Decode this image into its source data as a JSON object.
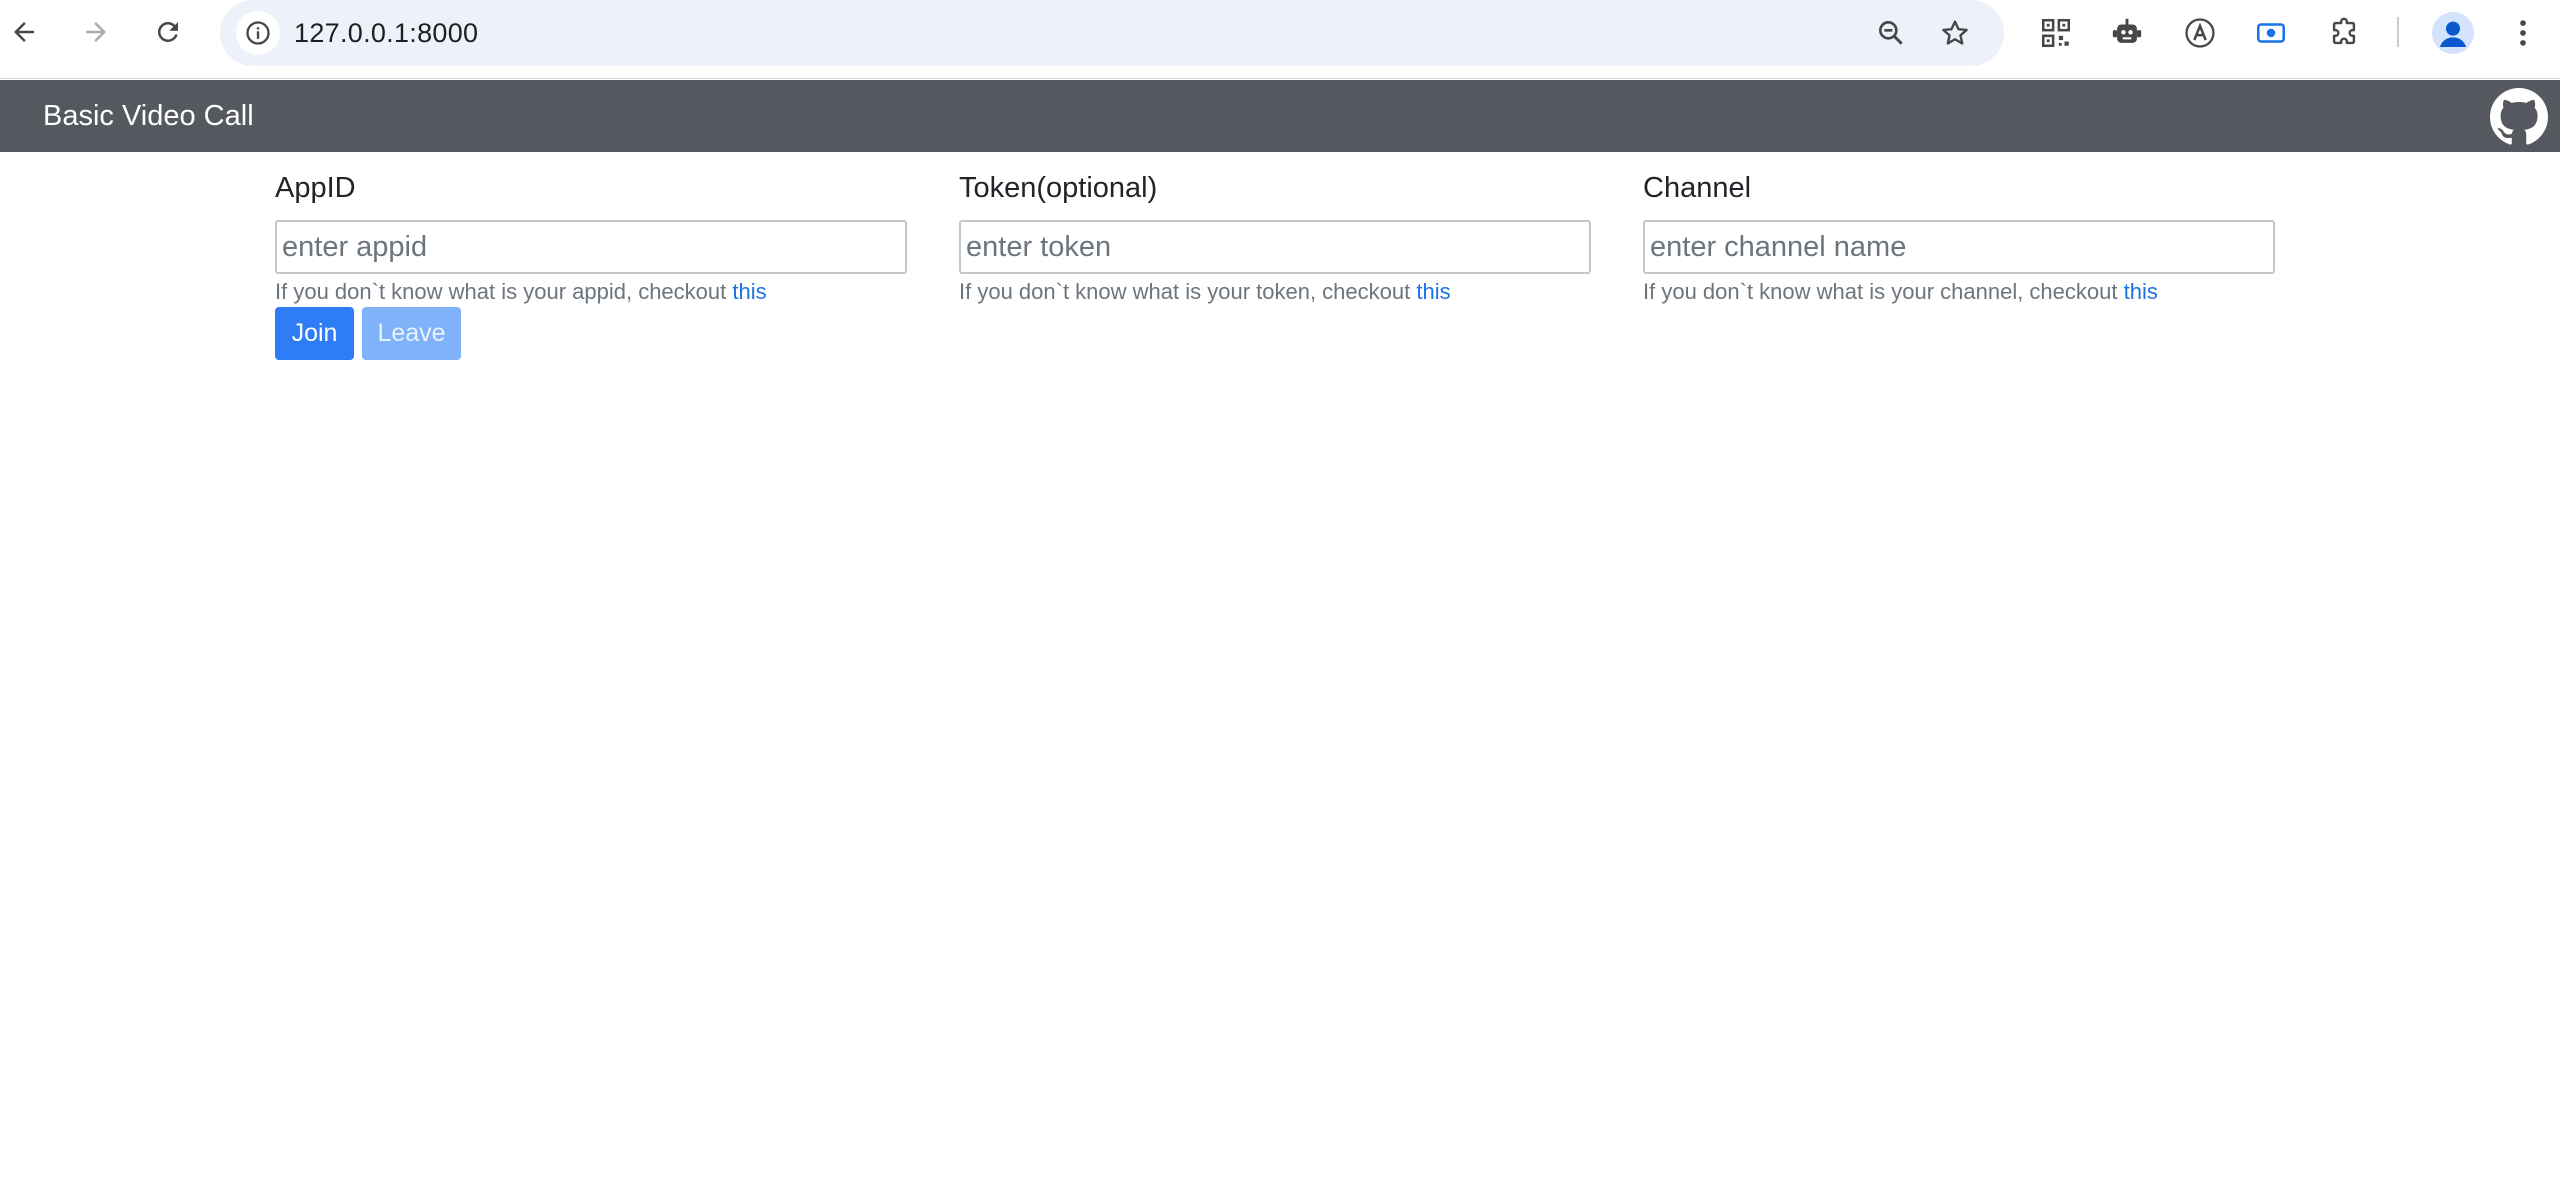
{
  "browser": {
    "url": "127.0.0.1:8000",
    "icons": [
      "back-arrow-icon",
      "forward-arrow-icon",
      "reload-icon",
      "info-icon",
      "zoom-out-icon",
      "star-icon",
      "qr-code-icon",
      "robot-icon",
      "translate-icon",
      "screen-record-icon",
      "puzzle-icon",
      "profile-icon",
      "kebab-menu-icon"
    ]
  },
  "navbar": {
    "brand": "Basic Video Call",
    "background_color": "#55595f"
  },
  "form": {
    "appid": {
      "label": "AppID",
      "placeholder": "enter appid",
      "help_text": "If you don`t know what is your appid, checkout ",
      "help_link": "this"
    },
    "token": {
      "label": "Token(optional)",
      "placeholder": "enter token",
      "help_text": "If you don`t know what is your token, checkout ",
      "help_link": "this"
    },
    "channel": {
      "label": "Channel",
      "placeholder": "enter channel name",
      "help_text": "If you don`t know what is your channel, checkout ",
      "help_link": "this"
    }
  },
  "buttons": {
    "join": "Join",
    "leave": "Leave",
    "primary_color": "#2f7df6"
  }
}
